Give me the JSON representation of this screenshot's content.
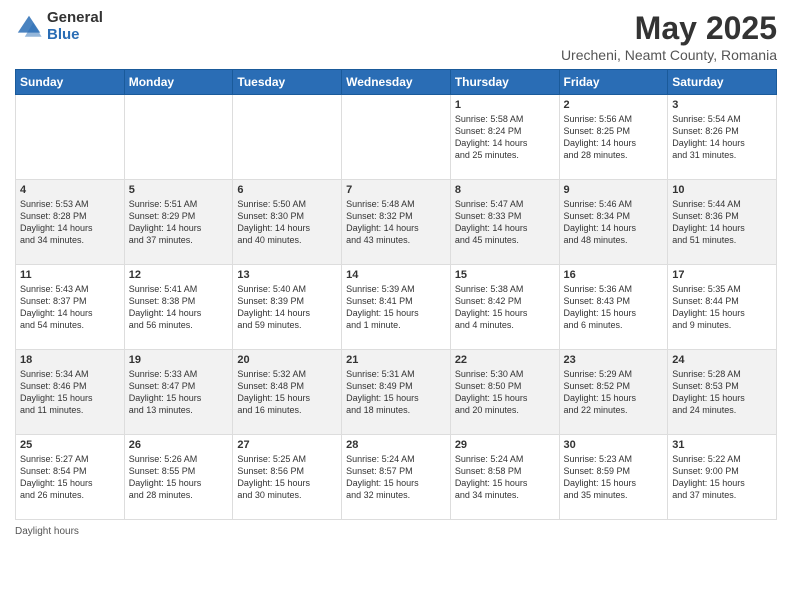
{
  "header": {
    "logo_general": "General",
    "logo_blue": "Blue",
    "main_title": "May 2025",
    "subtitle": "Urecheni, Neamt County, Romania"
  },
  "weekdays": [
    "Sunday",
    "Monday",
    "Tuesday",
    "Wednesday",
    "Thursday",
    "Friday",
    "Saturday"
  ],
  "weeks": [
    [
      {
        "day": "",
        "info": ""
      },
      {
        "day": "",
        "info": ""
      },
      {
        "day": "",
        "info": ""
      },
      {
        "day": "",
        "info": ""
      },
      {
        "day": "1",
        "info": "Sunrise: 5:58 AM\nSunset: 8:24 PM\nDaylight: 14 hours\nand 25 minutes."
      },
      {
        "day": "2",
        "info": "Sunrise: 5:56 AM\nSunset: 8:25 PM\nDaylight: 14 hours\nand 28 minutes."
      },
      {
        "day": "3",
        "info": "Sunrise: 5:54 AM\nSunset: 8:26 PM\nDaylight: 14 hours\nand 31 minutes."
      }
    ],
    [
      {
        "day": "4",
        "info": "Sunrise: 5:53 AM\nSunset: 8:28 PM\nDaylight: 14 hours\nand 34 minutes."
      },
      {
        "day": "5",
        "info": "Sunrise: 5:51 AM\nSunset: 8:29 PM\nDaylight: 14 hours\nand 37 minutes."
      },
      {
        "day": "6",
        "info": "Sunrise: 5:50 AM\nSunset: 8:30 PM\nDaylight: 14 hours\nand 40 minutes."
      },
      {
        "day": "7",
        "info": "Sunrise: 5:48 AM\nSunset: 8:32 PM\nDaylight: 14 hours\nand 43 minutes."
      },
      {
        "day": "8",
        "info": "Sunrise: 5:47 AM\nSunset: 8:33 PM\nDaylight: 14 hours\nand 45 minutes."
      },
      {
        "day": "9",
        "info": "Sunrise: 5:46 AM\nSunset: 8:34 PM\nDaylight: 14 hours\nand 48 minutes."
      },
      {
        "day": "10",
        "info": "Sunrise: 5:44 AM\nSunset: 8:36 PM\nDaylight: 14 hours\nand 51 minutes."
      }
    ],
    [
      {
        "day": "11",
        "info": "Sunrise: 5:43 AM\nSunset: 8:37 PM\nDaylight: 14 hours\nand 54 minutes."
      },
      {
        "day": "12",
        "info": "Sunrise: 5:41 AM\nSunset: 8:38 PM\nDaylight: 14 hours\nand 56 minutes."
      },
      {
        "day": "13",
        "info": "Sunrise: 5:40 AM\nSunset: 8:39 PM\nDaylight: 14 hours\nand 59 minutes."
      },
      {
        "day": "14",
        "info": "Sunrise: 5:39 AM\nSunset: 8:41 PM\nDaylight: 15 hours\nand 1 minute."
      },
      {
        "day": "15",
        "info": "Sunrise: 5:38 AM\nSunset: 8:42 PM\nDaylight: 15 hours\nand 4 minutes."
      },
      {
        "day": "16",
        "info": "Sunrise: 5:36 AM\nSunset: 8:43 PM\nDaylight: 15 hours\nand 6 minutes."
      },
      {
        "day": "17",
        "info": "Sunrise: 5:35 AM\nSunset: 8:44 PM\nDaylight: 15 hours\nand 9 minutes."
      }
    ],
    [
      {
        "day": "18",
        "info": "Sunrise: 5:34 AM\nSunset: 8:46 PM\nDaylight: 15 hours\nand 11 minutes."
      },
      {
        "day": "19",
        "info": "Sunrise: 5:33 AM\nSunset: 8:47 PM\nDaylight: 15 hours\nand 13 minutes."
      },
      {
        "day": "20",
        "info": "Sunrise: 5:32 AM\nSunset: 8:48 PM\nDaylight: 15 hours\nand 16 minutes."
      },
      {
        "day": "21",
        "info": "Sunrise: 5:31 AM\nSunset: 8:49 PM\nDaylight: 15 hours\nand 18 minutes."
      },
      {
        "day": "22",
        "info": "Sunrise: 5:30 AM\nSunset: 8:50 PM\nDaylight: 15 hours\nand 20 minutes."
      },
      {
        "day": "23",
        "info": "Sunrise: 5:29 AM\nSunset: 8:52 PM\nDaylight: 15 hours\nand 22 minutes."
      },
      {
        "day": "24",
        "info": "Sunrise: 5:28 AM\nSunset: 8:53 PM\nDaylight: 15 hours\nand 24 minutes."
      }
    ],
    [
      {
        "day": "25",
        "info": "Sunrise: 5:27 AM\nSunset: 8:54 PM\nDaylight: 15 hours\nand 26 minutes."
      },
      {
        "day": "26",
        "info": "Sunrise: 5:26 AM\nSunset: 8:55 PM\nDaylight: 15 hours\nand 28 minutes."
      },
      {
        "day": "27",
        "info": "Sunrise: 5:25 AM\nSunset: 8:56 PM\nDaylight: 15 hours\nand 30 minutes."
      },
      {
        "day": "28",
        "info": "Sunrise: 5:24 AM\nSunset: 8:57 PM\nDaylight: 15 hours\nand 32 minutes."
      },
      {
        "day": "29",
        "info": "Sunrise: 5:24 AM\nSunset: 8:58 PM\nDaylight: 15 hours\nand 34 minutes."
      },
      {
        "day": "30",
        "info": "Sunrise: 5:23 AM\nSunset: 8:59 PM\nDaylight: 15 hours\nand 35 minutes."
      },
      {
        "day": "31",
        "info": "Sunrise: 5:22 AM\nSunset: 9:00 PM\nDaylight: 15 hours\nand 37 minutes."
      }
    ]
  ],
  "footer": {
    "daylight_label": "Daylight hours"
  }
}
